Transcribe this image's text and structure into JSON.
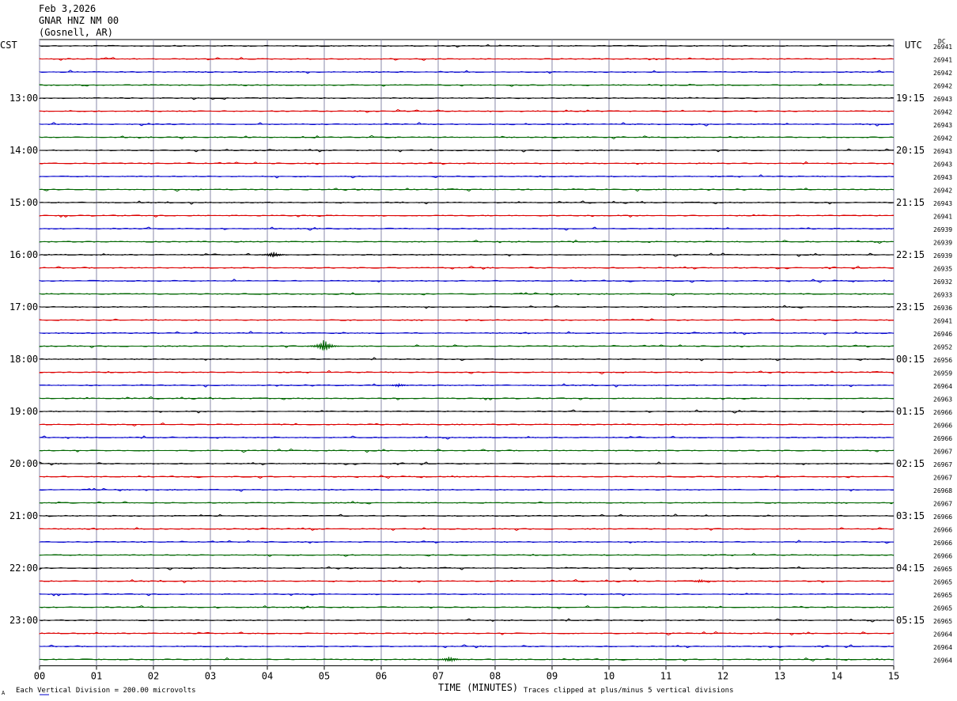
{
  "header": {
    "date": "Feb 3,2026",
    "station": "GNAR HNZ NM 00",
    "location": "(Gosnell, AR)"
  },
  "left_tz": "CST",
  "right_tz": "UTC",
  "dc_label": "DC",
  "chart_data": {
    "type": "line",
    "title": "",
    "xlabel": "TIME (MINUTES)",
    "ylabel": "",
    "xlim": [
      0,
      15
    ],
    "x_ticks": [
      "00",
      "01",
      "02",
      "03",
      "04",
      "05",
      "06",
      "07",
      "08",
      "09",
      "10",
      "11",
      "12",
      "13",
      "14",
      "15"
    ],
    "row_colors": [
      "#000000",
      "#dd0000",
      "#0000cc",
      "#006600"
    ],
    "grid": true,
    "left_hour_labels": [
      "13:00",
      "14:00",
      "15:00",
      "16:00",
      "17:00",
      "18:00",
      "19:00",
      "20:00",
      "21:00",
      "22:00",
      "23:00"
    ],
    "right_hour_labels": [
      "19:15",
      "20:15",
      "21:15",
      "22:15",
      "23:15",
      "00:15",
      "01:15",
      "02:15",
      "03:15",
      "04:15",
      "05:15"
    ],
    "dc_offsets": [
      "26941",
      "26941",
      "26942",
      "26942",
      "26943",
      "26942",
      "26943",
      "26942",
      "26943",
      "26943",
      "26943",
      "26942",
      "26943",
      "26941",
      "26939",
      "26939",
      "26939",
      "26935",
      "26932",
      "26933",
      "26936",
      "26941",
      "26946",
      "26952",
      "26956",
      "26959",
      "26964",
      "26963",
      "26966",
      "26966",
      "26966",
      "26967",
      "26967",
      "26967",
      "26968",
      "26967",
      "26966",
      "26966",
      "26966",
      "26966",
      "26965",
      "26965",
      "26965",
      "26965",
      "26965",
      "26964",
      "26964",
      "26964"
    ],
    "events": [
      {
        "trace": 16,
        "minute": 4.1,
        "amplitude": 4
      },
      {
        "trace": 23,
        "minute": 5.0,
        "amplitude": 9
      },
      {
        "trace": 26,
        "minute": 6.3,
        "amplitude": 2
      },
      {
        "trace": 41,
        "minute": 11.6,
        "amplitude": 2
      },
      {
        "trace": 47,
        "minute": 7.2,
        "amplitude": 4
      }
    ]
  },
  "footer": {
    "scale_note": "Each Vertical Division =  200.00 microvolts",
    "clip_note": "Traces clipped at plus/minus 5 vertical divisions",
    "corner_mark": "A"
  }
}
